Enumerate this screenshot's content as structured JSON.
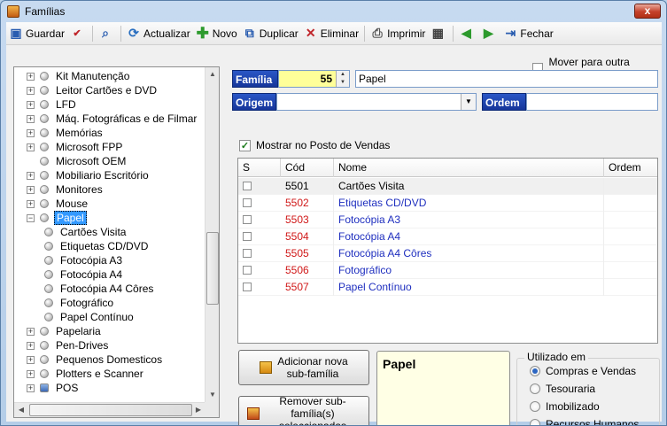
{
  "window": {
    "title": "Famílias",
    "close_label": "x"
  },
  "toolbar": {
    "guardar": "Guardar",
    "actualizar": "Actualizar",
    "novo": "Novo",
    "duplicar": "Duplicar",
    "eliminar": "Eliminar",
    "imprimir": "Imprimir",
    "fechar": "Fechar"
  },
  "tree": {
    "items": [
      {
        "label": "Kit Manutenção",
        "level": 1,
        "expander": "+"
      },
      {
        "label": "Leitor Cartões e DVD",
        "level": 1,
        "expander": "+"
      },
      {
        "label": "LFD",
        "level": 1,
        "expander": "+"
      },
      {
        "label": "Máq. Fotográficas e de Filmar",
        "level": 1,
        "expander": "+"
      },
      {
        "label": "Memórias",
        "level": 1,
        "expander": "+"
      },
      {
        "label": "Microsoft FPP",
        "level": 1,
        "expander": "+"
      },
      {
        "label": "Microsoft OEM",
        "level": 1,
        "expander": ""
      },
      {
        "label": "Mobiliario Escritório",
        "level": 1,
        "expander": "+"
      },
      {
        "label": "Monitores",
        "level": 1,
        "expander": "+"
      },
      {
        "label": "Mouse",
        "level": 1,
        "expander": "+"
      },
      {
        "label": "Papel",
        "level": 1,
        "expander": "−",
        "selected": true
      },
      {
        "label": "Cartões Visita",
        "level": 2,
        "expander": ""
      },
      {
        "label": "Etiquetas CD/DVD",
        "level": 2,
        "expander": ""
      },
      {
        "label": "Fotocópia A3",
        "level": 2,
        "expander": ""
      },
      {
        "label": "Fotocópia A4",
        "level": 2,
        "expander": ""
      },
      {
        "label": "Fotocópia A4 Côres",
        "level": 2,
        "expander": ""
      },
      {
        "label": "Fotográfico",
        "level": 2,
        "expander": ""
      },
      {
        "label": "Papel Contínuo",
        "level": 2,
        "expander": ""
      },
      {
        "label": "Papelaria",
        "level": 1,
        "expander": "+"
      },
      {
        "label": "Pen-Drives",
        "level": 1,
        "expander": "+"
      },
      {
        "label": "Pequenos Domesticos",
        "level": 1,
        "expander": "+"
      },
      {
        "label": "Plotters e Scanner",
        "level": 1,
        "expander": "+"
      },
      {
        "label": "POS",
        "level": 1,
        "expander": "+"
      }
    ]
  },
  "form": {
    "mover_label": "Mover para outra família",
    "familia_label": "Família",
    "familia_code": "55",
    "familia_name": "Papel",
    "origem_label": "Origem",
    "origem_value": "",
    "ordem_label": "Ordem",
    "ordem_value": "",
    "mostrar_label": "Mostrar no Posto de Vendas",
    "mostrar_checked": true
  },
  "grid": {
    "headers": {
      "s": "S",
      "cod": "Cód",
      "nome": "Nome",
      "ordem": "Ordem"
    },
    "rows": [
      {
        "cod": "5501",
        "nome": "Cartões Visita",
        "ordem": "",
        "cod_color": "#000000",
        "nome_color": "#000000"
      },
      {
        "cod": "5502",
        "nome": "Etiquetas CD/DVD",
        "ordem": "",
        "cod_color": "#d01818",
        "nome_color": "#1f2fbf"
      },
      {
        "cod": "5503",
        "nome": "Fotocópia A3",
        "ordem": "",
        "cod_color": "#d01818",
        "nome_color": "#1f2fbf"
      },
      {
        "cod": "5504",
        "nome": "Fotocópia A4",
        "ordem": "",
        "cod_color": "#d01818",
        "nome_color": "#1f2fbf"
      },
      {
        "cod": "5505",
        "nome": "Fotocópia A4 Côres",
        "ordem": "",
        "cod_color": "#d01818",
        "nome_color": "#1f2fbf"
      },
      {
        "cod": "5506",
        "nome": "Fotográfico",
        "ordem": "",
        "cod_color": "#d01818",
        "nome_color": "#1f2fbf"
      },
      {
        "cod": "5507",
        "nome": "Papel Contínuo",
        "ordem": "",
        "cod_color": "#d01818",
        "nome_color": "#1f2fbf"
      }
    ]
  },
  "buttons": {
    "adicionar": "Adicionar nova sub-família",
    "remover": "Remover sub-família(s) seleccionadas"
  },
  "preview_text": "Papel",
  "utilizado": {
    "title": "Utilizado em",
    "options": [
      {
        "label": "Compras e Vendas",
        "selected": true
      },
      {
        "label": "Tesouraria",
        "selected": false
      },
      {
        "label": "Imobilizado",
        "selected": false
      },
      {
        "label": "Recursos Humanos",
        "selected": false
      }
    ]
  }
}
